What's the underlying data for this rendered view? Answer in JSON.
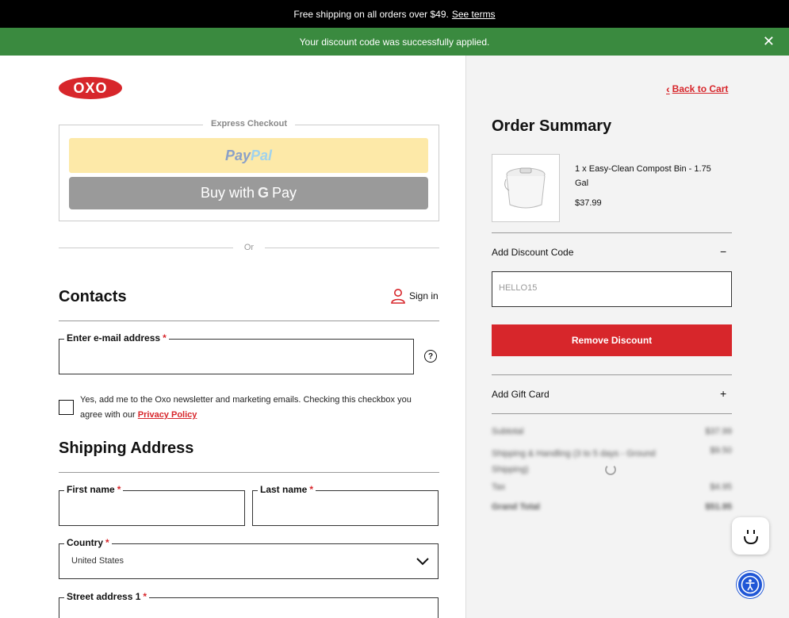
{
  "banner": {
    "text": "Free shipping on all orders over $49.",
    "link": "See terms"
  },
  "notice": {
    "text": "Your discount code was successfully applied.",
    "close_icon": "close-icon"
  },
  "logo": {
    "text": "OXO",
    "color": "#d7262b"
  },
  "express": {
    "legend": "Express Checkout",
    "paypal_text_1": "Pay",
    "paypal_text_2": "Pal",
    "gpay_prefix": "Buy with",
    "gpay_g": "G",
    "gpay_suffix": "Pay"
  },
  "divider_or": "Or",
  "contacts": {
    "title": "Contacts",
    "signin": "Sign in",
    "email_label": "Enter e-mail address",
    "required_mark": "*",
    "newsletter_text": "Yes, add me to the Oxo newsletter and marketing emails. Checking this checkbox you agree with our",
    "privacy_link": "Privacy Policy",
    "help_icon": "?"
  },
  "shipping": {
    "title": "Shipping Address",
    "first_name_label": "First name",
    "last_name_label": "Last name",
    "country_label": "Country",
    "country_value": "United States",
    "street_label": "Street address 1"
  },
  "summary": {
    "back_label": "Back to Cart",
    "title": "Order Summary",
    "item_name": "1 x Easy-Clean Compost Bin - 1.75 Gal",
    "item_price": "$37.99",
    "discount_label": "Add Discount Code",
    "discount_toggle": "−",
    "discount_code": "HELLO15",
    "remove_button": "Remove Discount",
    "gift_label": "Add Gift Card",
    "gift_toggle": "+",
    "totals": [
      {
        "label": "Subtotal",
        "value": "$37.99"
      },
      {
        "label": "Shipping & Handling (3 to 5 days - Ground Shipping)",
        "value": "$9.50"
      },
      {
        "label": "Tax",
        "value": "$4.95"
      },
      {
        "label": "Grand Total",
        "value": "$51.95"
      }
    ]
  },
  "colors": {
    "accent": "#d7262b",
    "success": "#3a8a3f",
    "accessibility": "#1f56d6"
  }
}
